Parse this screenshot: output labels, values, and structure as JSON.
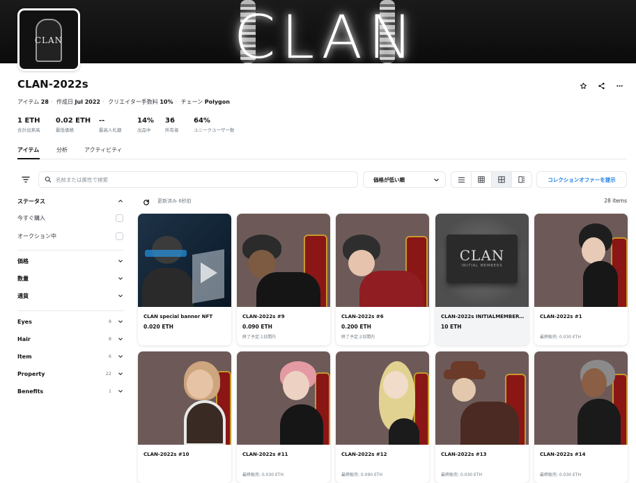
{
  "banner": {
    "title": "CLAN"
  },
  "avatar": {
    "label": "CLAN"
  },
  "collection": {
    "title": "CLAN-2022s",
    "meta": [
      {
        "label": "アイテム",
        "value": "28"
      },
      {
        "label": "作成日",
        "value": "Jul 2022"
      },
      {
        "label": "クリエイター手数料",
        "value": "10%"
      },
      {
        "label": "チェーン",
        "value": "Polygon"
      }
    ]
  },
  "header_actions": [
    "star-icon",
    "share-icon",
    "more-icon"
  ],
  "stats": [
    {
      "value": "1 ETH",
      "label": "合計出来高"
    },
    {
      "value": "0.02 ETH",
      "label": "最低価格"
    },
    {
      "value": "--",
      "label": "最高入札額"
    },
    {
      "value": "14%",
      "label": "出品中"
    },
    {
      "value": "36",
      "label": "所有者"
    },
    {
      "value": "64%",
      "label": "ユニークユーザー数"
    }
  ],
  "tabs": [
    {
      "label": "アイテム",
      "active": true
    },
    {
      "label": "分析",
      "active": false
    },
    {
      "label": "アクティビティ",
      "active": false
    }
  ],
  "toolbar": {
    "search_placeholder": "名前または属性で検索",
    "sort_label": "価格が低い順",
    "offer_button": "コレクションオファーを提示",
    "views": [
      "list-view-icon",
      "grid-small-icon",
      "grid-large-icon",
      "gallery-view-icon"
    ],
    "active_view": "grid-large-icon"
  },
  "sidebar": {
    "status": {
      "title": "ステータス",
      "options": [
        "今すぐ購入",
        "オークション中"
      ]
    },
    "filters": [
      "価格",
      "数量",
      "通貨"
    ],
    "traits": [
      {
        "name": "Eyes",
        "count": "8"
      },
      {
        "name": "Hair",
        "count": "8"
      },
      {
        "name": "Item",
        "count": "6"
      },
      {
        "name": "Property",
        "count": "22"
      },
      {
        "name": "Benefits",
        "count": "1"
      }
    ]
  },
  "grid": {
    "updated": "更新済み 6秒前",
    "count": "28 items",
    "items": [
      {
        "name": "CLAN special banner NFT",
        "price": "0.020 ETH",
        "sub": ""
      },
      {
        "name": "CLAN-2022s #9",
        "price": "0.090 ETH",
        "sub": "終了予定:1日間内"
      },
      {
        "name": "CLAN-2022s #6",
        "price": "0.200 ETH",
        "sub": "終了予定:2日間内"
      },
      {
        "name": "CLAN-2022s INITIALMEMBERSCA...",
        "price": "10 ETH",
        "sub": "",
        "card_text_1": "CLAN",
        "card_text_2": "INITIAL MEMBERS"
      },
      {
        "name": "CLAN-2022s #1",
        "price": "",
        "sub": "最終販売: 0.030 ETH"
      },
      {
        "name": "CLAN-2022s #10",
        "price": "",
        "sub": ""
      },
      {
        "name": "CLAN-2022s #11",
        "price": "",
        "sub": "最終販売: 0.030 ETH"
      },
      {
        "name": "CLAN-2022s #12",
        "price": "",
        "sub": "最終販売: 0.090 ETH"
      },
      {
        "name": "CLAN-2022s #13",
        "price": "",
        "sub": "最終販売: 0.030 ETH"
      },
      {
        "name": "CLAN-2022s #14",
        "price": "",
        "sub": "最終販売: 0.030 ETH"
      }
    ]
  }
}
